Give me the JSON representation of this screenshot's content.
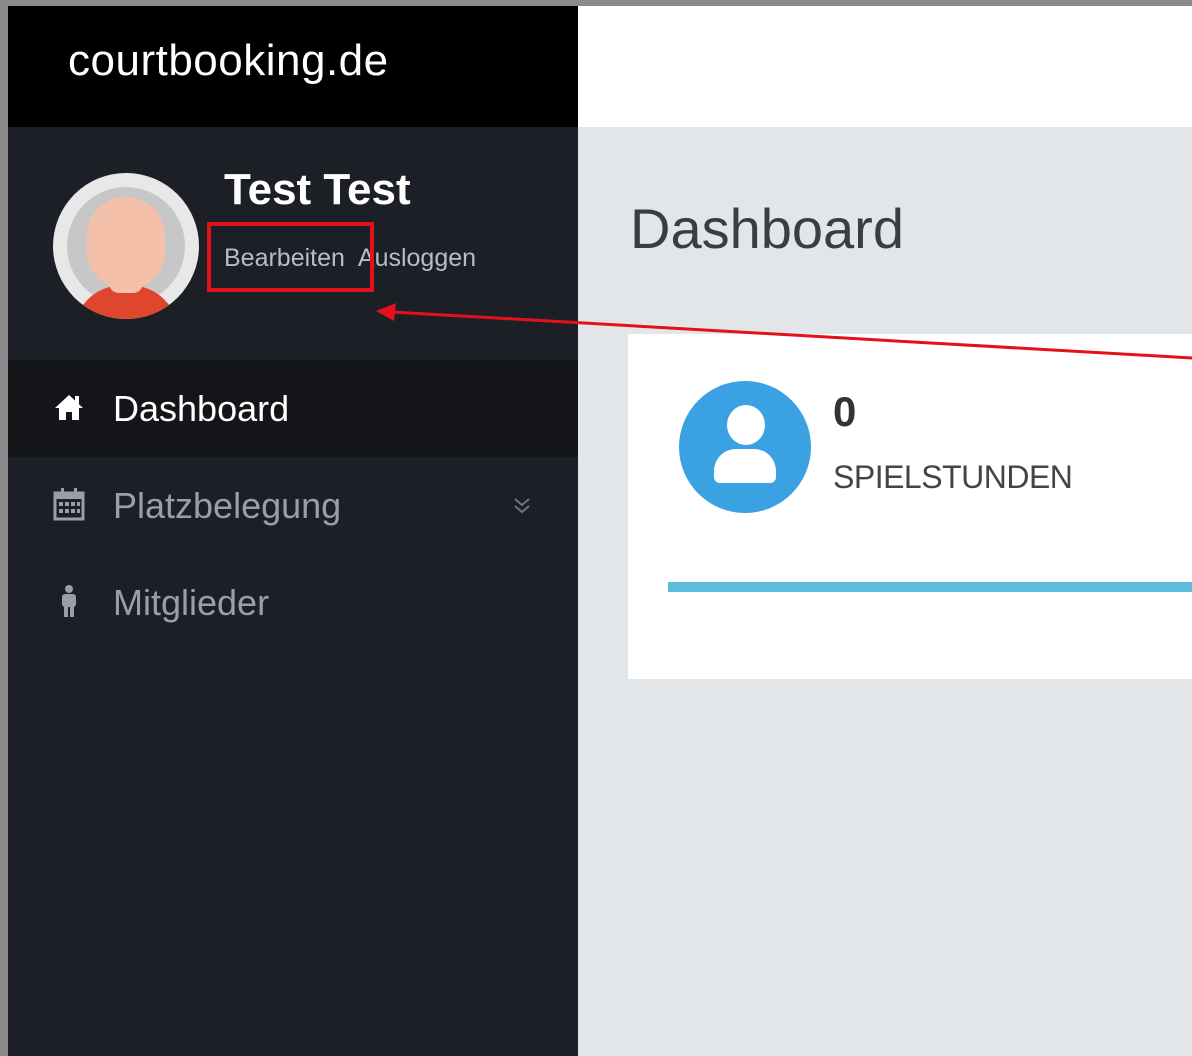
{
  "brand": {
    "logo_text": "courtbooking.de"
  },
  "user": {
    "name": "Test Test",
    "edit_label": "Bearbeiten",
    "logout_label": "Ausloggen"
  },
  "sidebar": {
    "items": [
      {
        "label": "Dashboard",
        "icon": "home-icon",
        "active": true
      },
      {
        "label": "Platzbelegung",
        "icon": "calendar-icon",
        "expandable": true
      },
      {
        "label": "Mitglieder",
        "icon": "person-icon"
      }
    ]
  },
  "main": {
    "title": "Dashboard",
    "stat": {
      "value": "0",
      "label": "SPIELSTUNDEN",
      "icon": "user-icon",
      "progress_percent": 100
    }
  },
  "colors": {
    "sidebar_bg": "#1d1f27",
    "logo_bg": "#000000",
    "content_bg": "#e3e6e9",
    "accent_blue": "#3aa1e2",
    "progress": "#5bbcdc",
    "annotation_red": "#e4101c"
  }
}
